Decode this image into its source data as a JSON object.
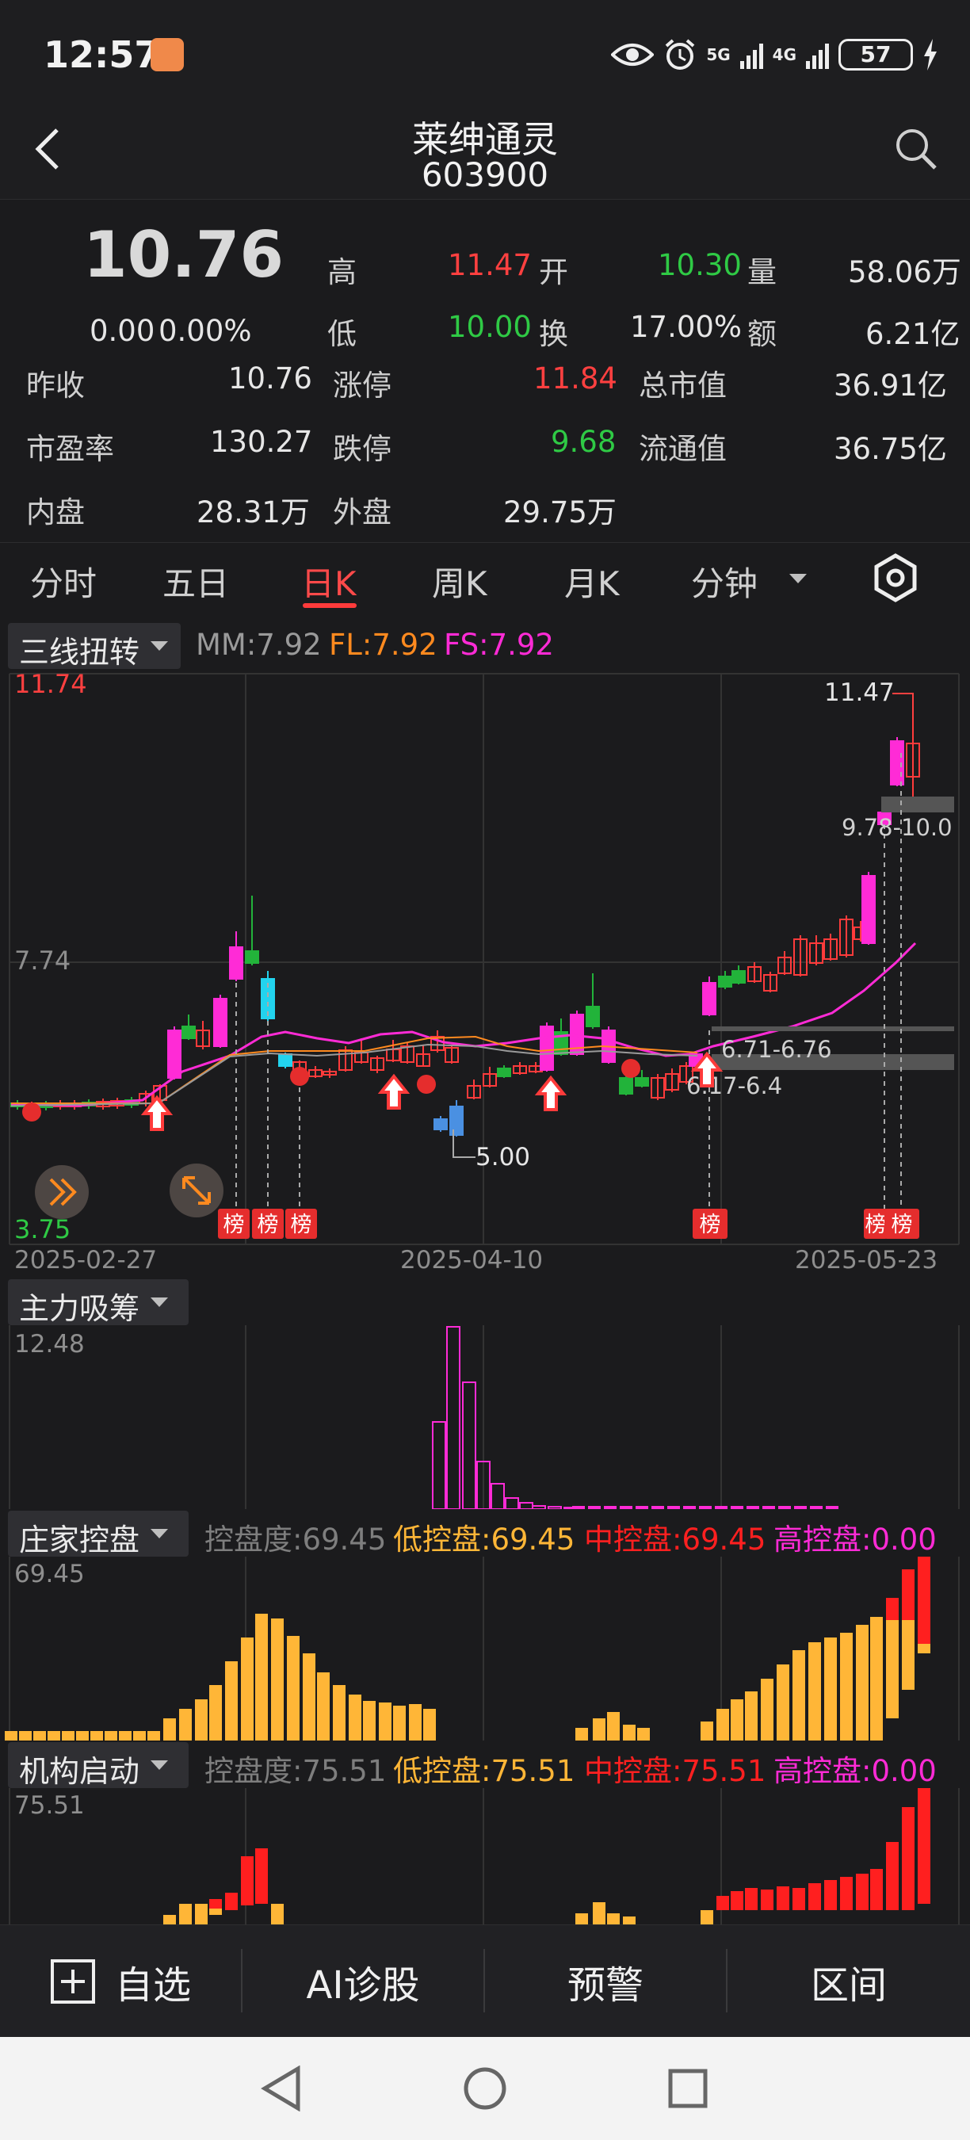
{
  "status_bar": {
    "time": "12:57",
    "network_1": "5G",
    "network_2": "4G",
    "battery": "57"
  },
  "header": {
    "stock_name": "莱绅通灵",
    "stock_code": "603900"
  },
  "quote": {
    "price": "10.76",
    "change": "0.00",
    "change_pct": "0.00%",
    "rows": [
      {
        "label": "高",
        "value": "11.47"
      },
      {
        "label": "开",
        "value": "10.30"
      },
      {
        "label": "量",
        "value": "58.06万"
      },
      {
        "label": "低",
        "value": "10.00"
      },
      {
        "label": "换",
        "value": "17.00%"
      },
      {
        "label": "额",
        "value": "6.21亿"
      },
      {
        "label": "昨收",
        "value": "10.76"
      },
      {
        "label": "涨停",
        "value": "11.84"
      },
      {
        "label": "总市值",
        "value": "36.91亿"
      },
      {
        "label": "市盈率",
        "value": "130.27"
      },
      {
        "label": "跌停",
        "value": "9.68"
      },
      {
        "label": "流通值",
        "value": "36.75亿"
      },
      {
        "label": "内盘",
        "value": "28.31万"
      },
      {
        "label": "外盘",
        "value": "29.75万"
      }
    ]
  },
  "tabs": [
    "分时",
    "五日",
    "日K",
    "周K",
    "月K",
    "分钟"
  ],
  "active_tab": "日K",
  "kline": {
    "indicator_name": "三线扭转",
    "mm": "MM:7.92",
    "fl": "FL:7.92",
    "fs": "FS:7.92",
    "price_top": "11.74",
    "price_mid": "7.74",
    "price_bottom": "3.75",
    "dates": [
      "2025-02-27",
      "2025-04-10",
      "2025-05-23"
    ],
    "annotations": {
      "high": "11.47",
      "low": "5.00",
      "zone_1": "6.71-6.76",
      "zone_2": "6.17-6.4",
      "zone_3": "9.78-10.0"
    },
    "bang_label": "榜",
    "bang_partial": "榜"
  },
  "panel_xichou": {
    "name": "主力吸筹",
    "max": "12.48"
  },
  "panel_zhuangjia": {
    "name": "庄家控盘",
    "kpd": "控盘度:69.45",
    "low": "低控盘:69.45",
    "mid": "中控盘:69.45",
    "high": "高控盘:0.00",
    "max": "69.45"
  },
  "panel_jigou": {
    "name": "机构启动",
    "kpd": "控盘度:75.51",
    "low": "低控盘:75.51",
    "mid": "中控盘:75.51",
    "high": "高控盘:0.00",
    "max": "75.51"
  },
  "bottom_bar": {
    "watchlist": "自选",
    "ai": "AI诊股",
    "alert": "预警",
    "range": "区间"
  },
  "colors": {
    "up": "#ff3b3b",
    "down": "#22b33a",
    "magenta": "#ff2bd6",
    "orange": "#ff8a1f",
    "gold": "#ffb637"
  }
}
